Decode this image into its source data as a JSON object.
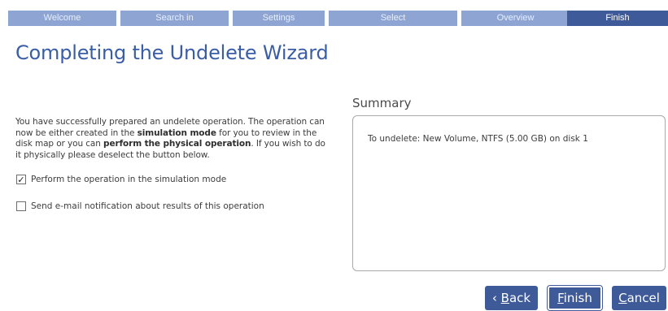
{
  "steps": [
    {
      "label": "Welcome"
    },
    {
      "label": "Search in"
    },
    {
      "label": "Settings"
    },
    {
      "label": "Select"
    },
    {
      "label": "Overview"
    },
    {
      "label": "Finish"
    }
  ],
  "active_step": "Finish",
  "title": "Completing the Undelete Wizard",
  "description": {
    "part1": "You have successfully prepared an undelete operation. The operation can now be either created in the ",
    "bold1": "simulation mode",
    "part2": " for you to review in the disk map or you can ",
    "bold2": "perform the physical operation",
    "part3": ". If you wish to do it physically please deselect the button below."
  },
  "options": [
    {
      "label": "Perform the operation in the simulation mode",
      "checked": true
    },
    {
      "label": "Send e-mail notification about results of this operation",
      "checked": false
    }
  ],
  "summary": {
    "title": "Summary",
    "line": "To undelete:  New Volume, NTFS (5.00 GB) on disk 1"
  },
  "buttons": {
    "back_prefix": "‹ ",
    "back_underlined": "B",
    "back_rest": "ack",
    "finish_underlined": "F",
    "finish_rest": "inish",
    "cancel_underlined": "C",
    "cancel_rest": "ancel"
  },
  "colors": {
    "step_inactive": "#8ea5d4",
    "step_active": "#3e5a99",
    "title": "#3a5da8",
    "button": "#3e5a99"
  }
}
